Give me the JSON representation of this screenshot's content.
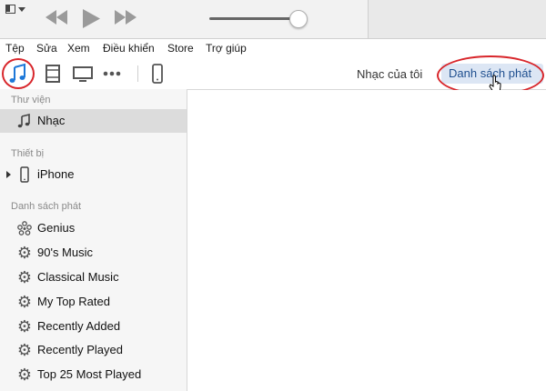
{
  "menu": [
    "Tệp",
    "Sửa",
    "Xem",
    "Điều khiển",
    "Store",
    "Trợ giúp"
  ],
  "nav": {
    "my_music": "Nhạc của tôi",
    "playlists": "Danh sách phát"
  },
  "sidebar": {
    "library_header": "Thư viện",
    "library_items": [
      {
        "label": "Nhạc",
        "icon": "music-note-icon"
      }
    ],
    "devices_header": "Thiết bị",
    "device_items": [
      {
        "label": "iPhone",
        "icon": "iphone-icon"
      }
    ],
    "playlists_header": "Danh sách phát",
    "playlist_items": [
      {
        "label": "Genius",
        "icon": "genius-icon"
      },
      {
        "label": "90's Music",
        "icon": "gear-icon"
      },
      {
        "label": "Classical Music",
        "icon": "gear-icon"
      },
      {
        "label": "My Top Rated",
        "icon": "gear-icon"
      },
      {
        "label": "Recently Added",
        "icon": "gear-icon"
      },
      {
        "label": "Recently Played",
        "icon": "gear-icon"
      },
      {
        "label": "Top 25 Most Played",
        "icon": "gear-icon"
      }
    ]
  },
  "colors": {
    "accent": "#1d78d8",
    "highlight": "#dce6f4",
    "annotation": "#d8262b"
  }
}
